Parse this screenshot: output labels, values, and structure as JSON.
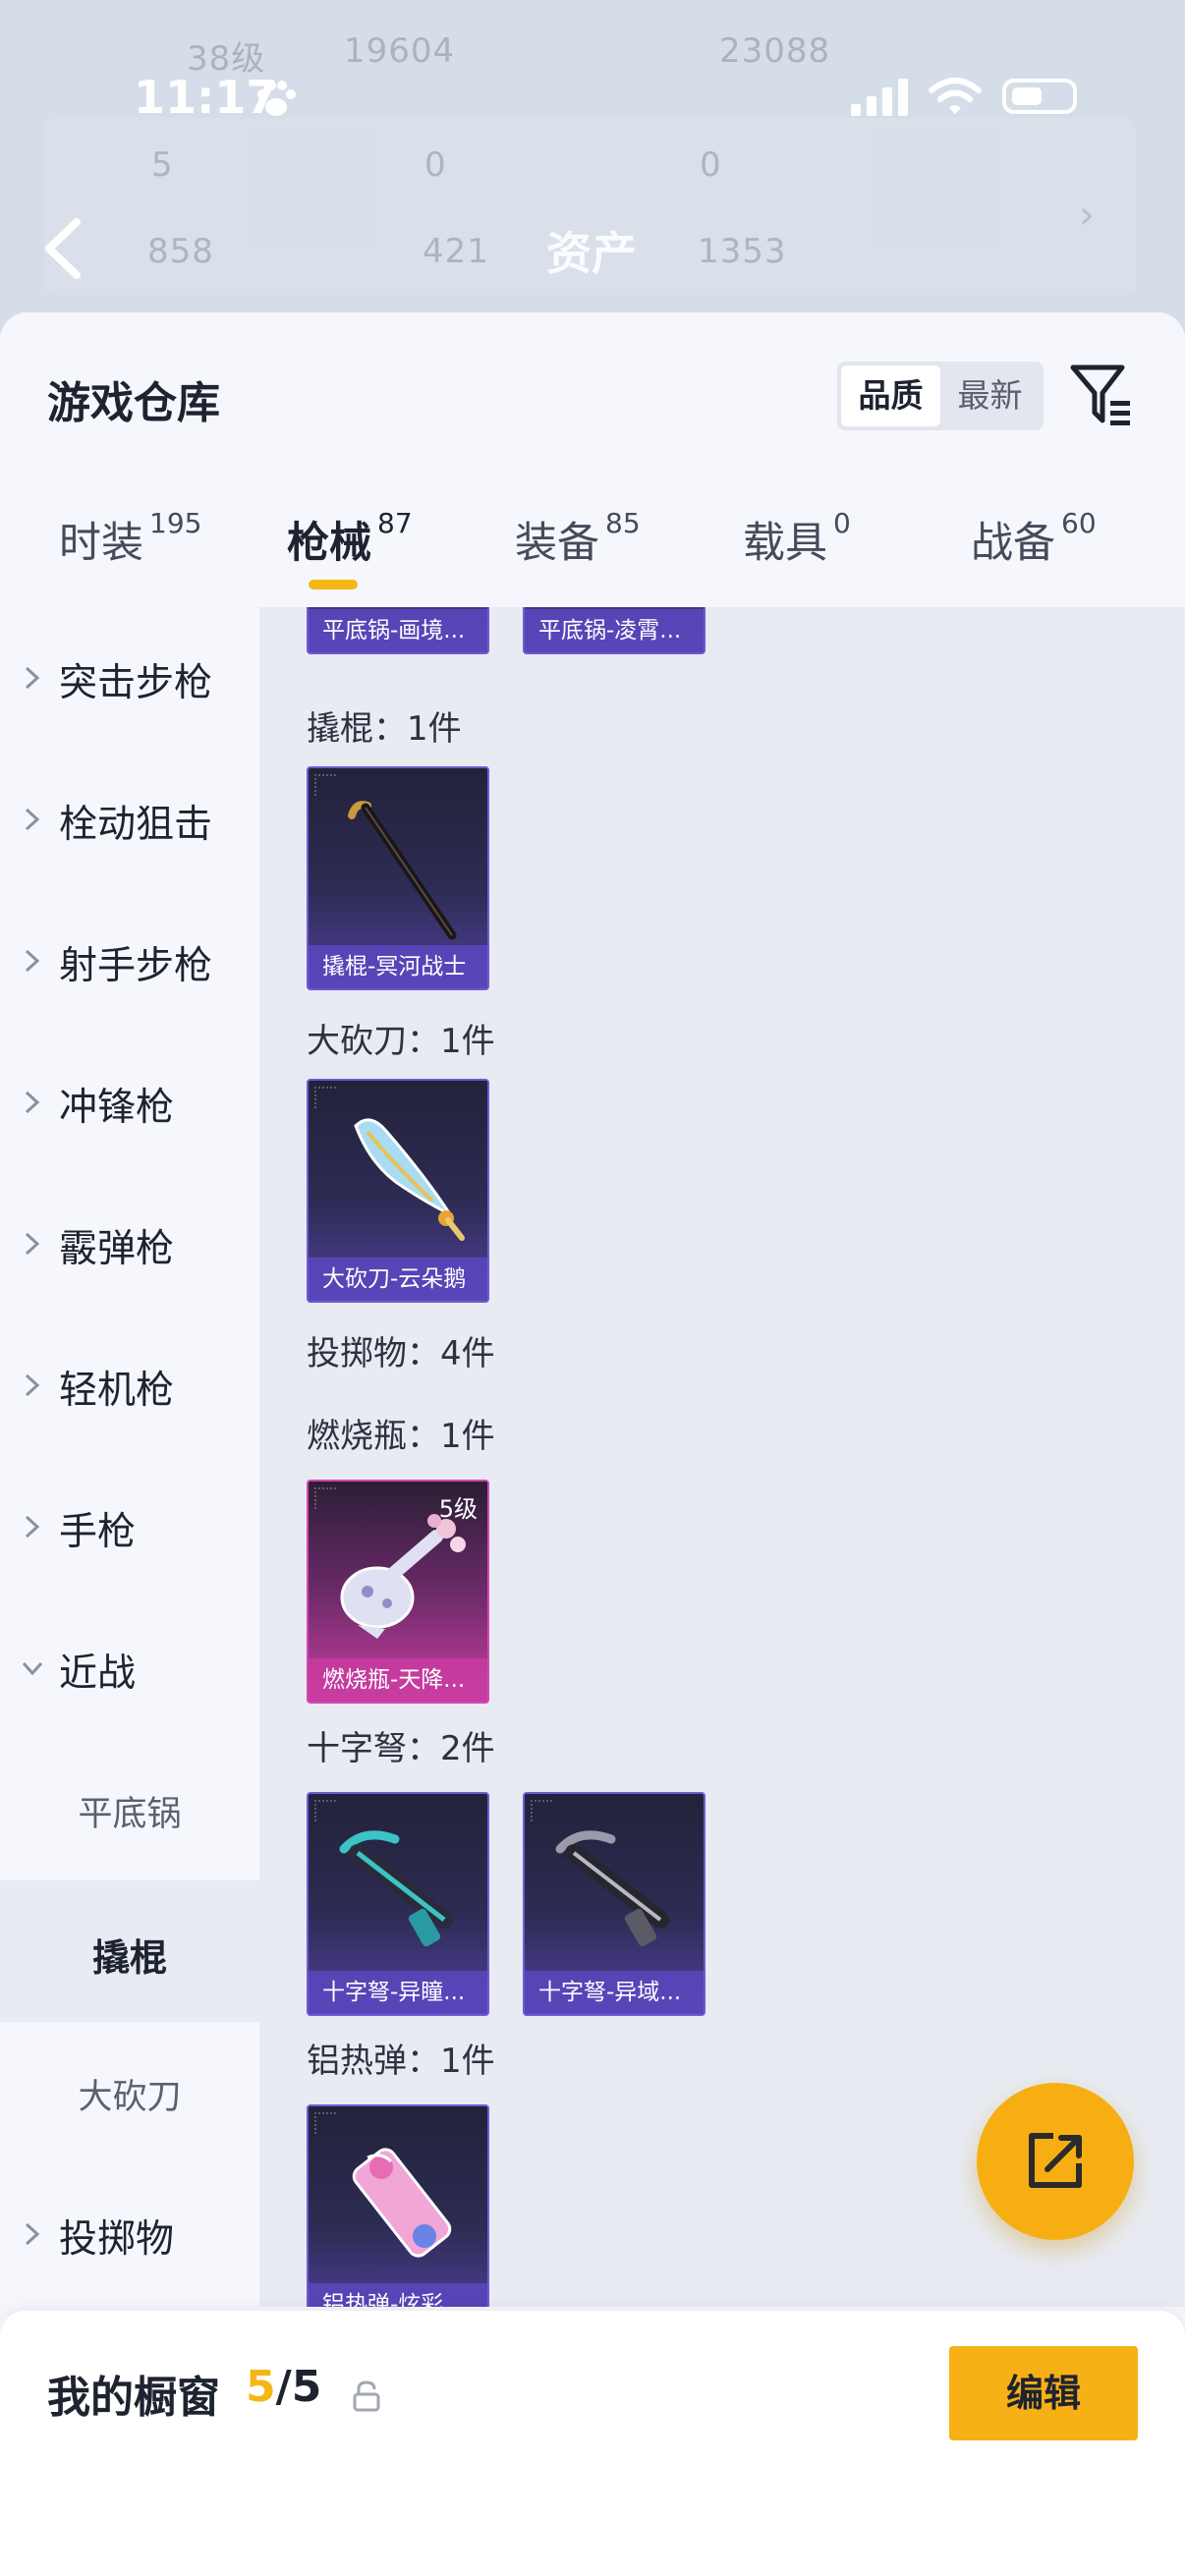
{
  "background": {
    "status_time": "11:17",
    "faded_lines": [
      "38级",
      "19604",
      "23088",
      "5",
      "0",
      "0",
      "858",
      "421",
      "1353"
    ],
    "title": "资产"
  },
  "header": {
    "title": "游戏仓库",
    "sort_options": [
      "品质",
      "最新"
    ],
    "active_sort": "品质"
  },
  "tabs": [
    {
      "label": "时装",
      "count": "195"
    },
    {
      "label": "枪械",
      "count": "87",
      "active": true
    },
    {
      "label": "装备",
      "count": "85"
    },
    {
      "label": "载具",
      "count": "0"
    },
    {
      "label": "战备",
      "count": "60"
    }
  ],
  "sidebar": {
    "categories": [
      {
        "label": "突击步枪"
      },
      {
        "label": "栓动狙击"
      },
      {
        "label": "射手步枪"
      },
      {
        "label": "冲锋枪"
      },
      {
        "label": "霰弹枪"
      },
      {
        "label": "轻机枪"
      },
      {
        "label": "手枪"
      },
      {
        "label": "近战",
        "expanded": true
      },
      {
        "label": "投掷物"
      }
    ],
    "subcategories": [
      {
        "label": "平底锅"
      },
      {
        "label": "撬棍",
        "active": true
      },
      {
        "label": "大砍刀"
      }
    ]
  },
  "content": {
    "top_items": [
      "平底锅-画境...",
      "平底锅-凌霄..."
    ],
    "sections": [
      {
        "label": "撬棍：1件",
        "items": [
          {
            "name": "撬棍-冥河战士",
            "icon": "crowbar-icon"
          }
        ]
      },
      {
        "label": "大砍刀：1件",
        "items": [
          {
            "name": "大砍刀-云朵鹅",
            "icon": "machete-icon"
          }
        ]
      },
      {
        "label": "投掷物：4件"
      },
      {
        "label": "燃烧瓶：1件",
        "items": [
          {
            "name": "燃烧瓶-天降...",
            "level": "5级",
            "icon": "molotov-icon"
          }
        ]
      },
      {
        "label": "十字弩：2件",
        "items": [
          {
            "name": "十字弩-异瞳...",
            "icon": "crossbow-icon"
          },
          {
            "name": "十字弩-异域...",
            "icon": "crossbow-icon"
          }
        ]
      },
      {
        "label": "铝热弹：1件",
        "items": [
          {
            "name": "铝热弹-炫彩...",
            "icon": "thermite-icon"
          }
        ]
      }
    ]
  },
  "showcase": {
    "label": "我的橱窗",
    "used": "5",
    "total": "/5",
    "edit_label": "编辑"
  },
  "colors": {
    "accent": "#f7b015",
    "card_border": "#6e5bd6",
    "card_pink": "#d247b3"
  }
}
